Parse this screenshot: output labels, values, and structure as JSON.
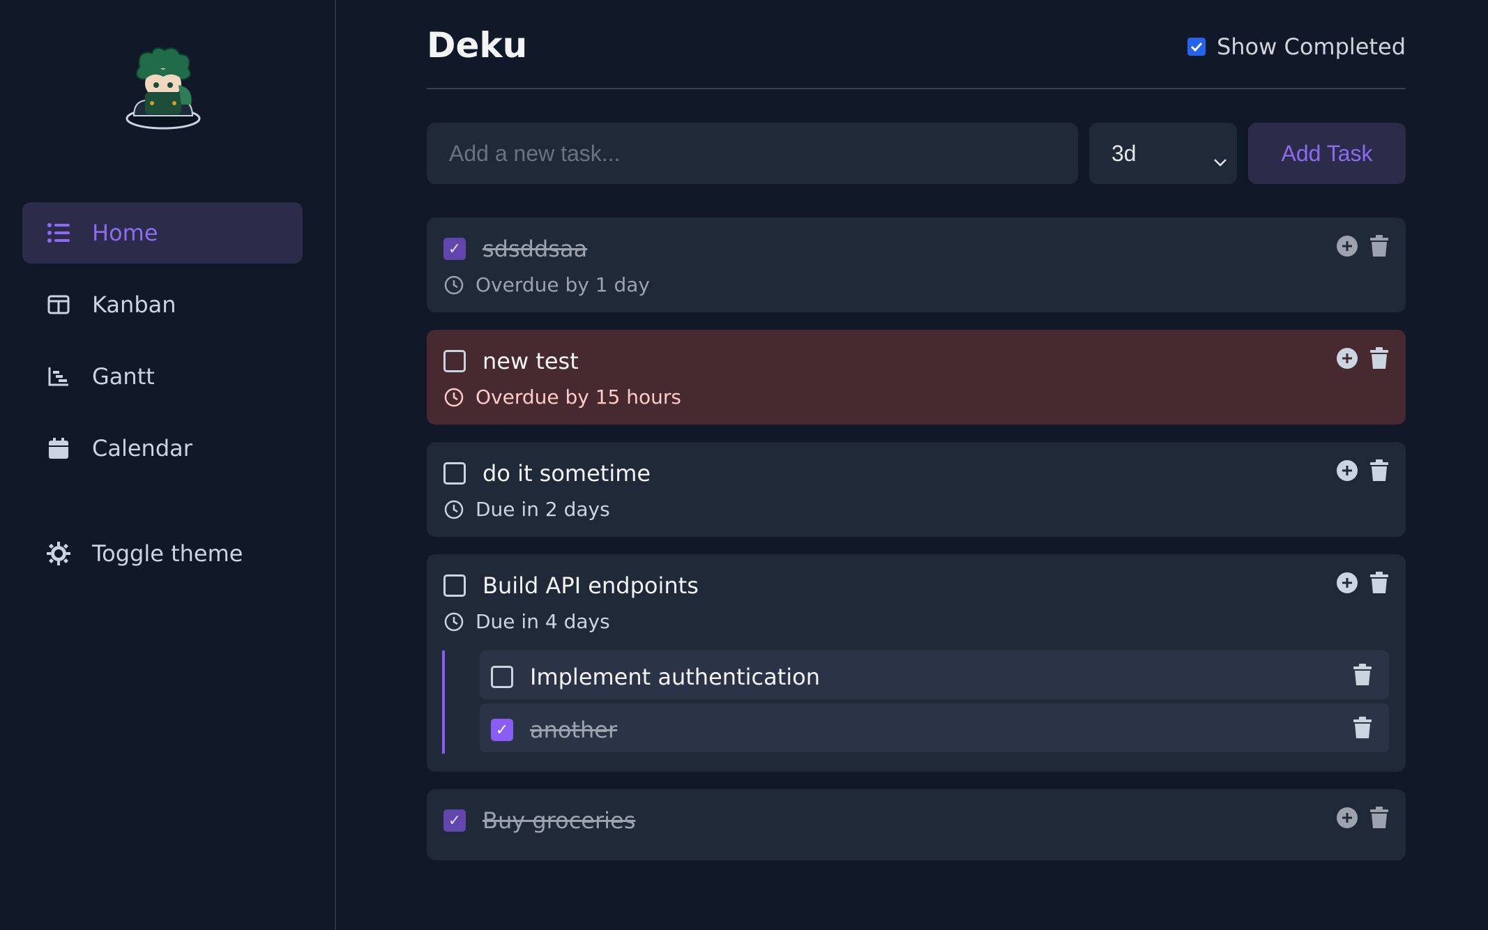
{
  "sidebar": {
    "items": [
      {
        "label": "Home",
        "icon": "list-icon",
        "active": true
      },
      {
        "label": "Kanban",
        "icon": "columns-icon"
      },
      {
        "label": "Gantt",
        "icon": "gantt-chart-icon"
      },
      {
        "label": "Calendar",
        "icon": "calendar-icon"
      }
    ],
    "theme_toggle": {
      "label": "Toggle theme",
      "icon": "sun-icon"
    }
  },
  "header": {
    "title": "Deku",
    "show_completed_label": "Show Completed",
    "show_completed_checked": true
  },
  "add_task": {
    "placeholder": "Add a new task...",
    "due_select_value": "3d",
    "button_label": "Add Task"
  },
  "tasks": [
    {
      "title": "sdsddsaa",
      "completed": true,
      "due_text": "Overdue by 1 day"
    },
    {
      "title": "new test",
      "completed": false,
      "overdue": true,
      "due_text": "Overdue by 15 hours"
    },
    {
      "title": "do it sometime",
      "completed": false,
      "due_text": "Due in 2 days"
    },
    {
      "title": "Build API endpoints",
      "completed": false,
      "due_text": "Due in 4 days",
      "subtasks": [
        {
          "title": "Implement authentication",
          "completed": false
        },
        {
          "title": "another",
          "completed": true
        }
      ]
    },
    {
      "title": "Buy groceries",
      "completed": true
    }
  ],
  "colors": {
    "background": "#111827",
    "card": "#1f2937",
    "overdue_card": "#472a2f",
    "accent": "#8b5cf6",
    "checkbox_blue": "#2563eb"
  }
}
